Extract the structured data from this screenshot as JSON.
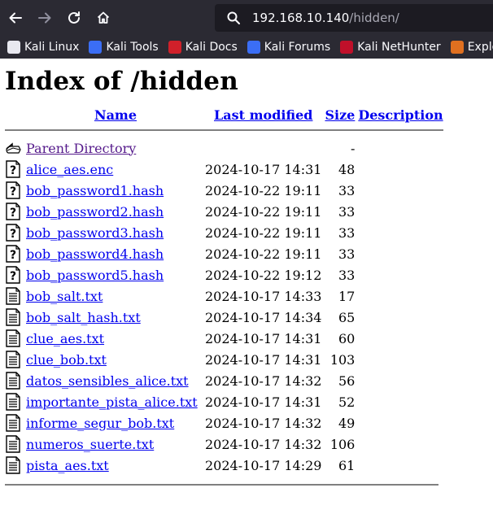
{
  "browser": {
    "url_host": "192.168.10.140",
    "url_path": "/hidden/",
    "bookmarks": [
      {
        "label": "Kali Linux",
        "icon": "kali-dragon-icon"
      },
      {
        "label": "Kali Tools",
        "icon": "kali-tools-icon"
      },
      {
        "label": "Kali Docs",
        "icon": "kali-docs-icon"
      },
      {
        "label": "Kali Forums",
        "icon": "kali-forums-icon"
      },
      {
        "label": "Kali NetHunter",
        "icon": "kali-nethunter-icon"
      },
      {
        "label": "Exploit-D",
        "icon": "exploit-db-icon"
      }
    ]
  },
  "page": {
    "title": "Index of /hidden",
    "columns": {
      "name": "Name",
      "modified": "Last modified",
      "size": "Size",
      "description": "Description"
    },
    "parent": {
      "name": "Parent Directory",
      "size": "-"
    },
    "files": [
      {
        "name": "alice_aes.enc",
        "modified": "2024-10-17 14:31",
        "size": "48",
        "type": "unknown"
      },
      {
        "name": "bob_password1.hash",
        "modified": "2024-10-22 19:11",
        "size": "33",
        "type": "unknown"
      },
      {
        "name": "bob_password2.hash",
        "modified": "2024-10-22 19:11",
        "size": "33",
        "type": "unknown"
      },
      {
        "name": "bob_password3.hash",
        "modified": "2024-10-22 19:11",
        "size": "33",
        "type": "unknown"
      },
      {
        "name": "bob_password4.hash",
        "modified": "2024-10-22 19:11",
        "size": "33",
        "type": "unknown"
      },
      {
        "name": "bob_password5.hash",
        "modified": "2024-10-22 19:12",
        "size": "33",
        "type": "unknown"
      },
      {
        "name": "bob_salt.txt",
        "modified": "2024-10-17 14:33",
        "size": "17",
        "type": "text"
      },
      {
        "name": "bob_salt_hash.txt",
        "modified": "2024-10-17 14:34",
        "size": "65",
        "type": "text"
      },
      {
        "name": "clue_aes.txt",
        "modified": "2024-10-17 14:31",
        "size": "60",
        "type": "text"
      },
      {
        "name": "clue_bob.txt",
        "modified": "2024-10-17 14:31",
        "size": "103",
        "type": "text"
      },
      {
        "name": "datos_sensibles_alice.txt",
        "modified": "2024-10-17 14:32",
        "size": "56",
        "type": "text"
      },
      {
        "name": "importante_pista_alice.txt",
        "modified": "2024-10-17 14:31",
        "size": "52",
        "type": "text"
      },
      {
        "name": "informe_segur_bob.txt",
        "modified": "2024-10-17 14:32",
        "size": "49",
        "type": "text"
      },
      {
        "name": "numeros_suerte.txt",
        "modified": "2024-10-17 14:32",
        "size": "106",
        "type": "text"
      },
      {
        "name": "pista_aes.txt",
        "modified": "2024-10-17 14:29",
        "size": "61",
        "type": "text"
      }
    ]
  }
}
